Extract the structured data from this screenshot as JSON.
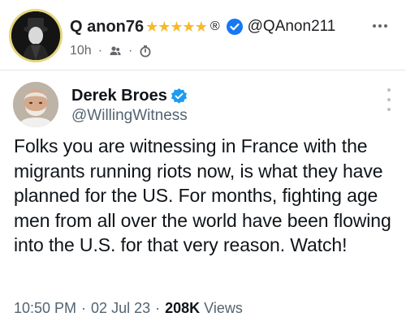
{
  "post": {
    "author_name": "Q anon76",
    "author_stars": "★★★★★",
    "author_registered_mark": "®",
    "author_handle": "@QAnon211",
    "time": "10h",
    "meta_separator": "·",
    "icons": {
      "avatar": "masked-figure-avatar",
      "verified": "verified-badge-icon",
      "visibility": "friends-icon",
      "timer": "timer-icon",
      "more": "more-options-icon"
    },
    "colors": {
      "stars": "#f7b928",
      "verified": "#1877f2",
      "meta": "#65676b"
    }
  },
  "tweet": {
    "name": "Derek Broes",
    "handle": "@WillingWitness",
    "text": "Folks you are witnessing in France with the migrants running riots now, is what they have planned for the US. For months, fighting age men from all over the world have been flowing into the U.S. for that very reason. Watch!",
    "time": "10:50 PM",
    "date": "02 Jul 23",
    "separator": "·",
    "views_count": "208K",
    "views_label": "Views",
    "icons": {
      "avatar": "bearded-man-avatar",
      "verified": "verified-badge-icon",
      "more": "vertical-more-icon"
    },
    "colors": {
      "verified": "#1d9bf0",
      "secondary": "#536471"
    }
  }
}
